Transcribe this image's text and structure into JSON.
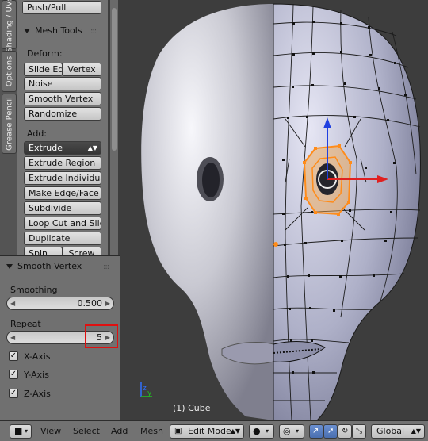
{
  "vertical_tabs": [
    "Shading / UVs",
    "Options",
    "Grease Pencil"
  ],
  "toolshelf": {
    "top_button": "Push/Pull",
    "mesh_tools": {
      "title": "Mesh Tools",
      "deform_label": "Deform:",
      "slide_edge": "Slide Ed",
      "vertex": "Vertex",
      "noise": "Noise",
      "smooth_vertex": "Smooth Vertex",
      "randomize": "Randomize",
      "add_label": "Add:",
      "extrude": "Extrude",
      "extrude_region": "Extrude Region",
      "extrude_individual": "Extrude Individual",
      "make_edge_face": "Make Edge/Face",
      "subdivide": "Subdivide",
      "loop_cut_slide": "Loop Cut and Slide",
      "duplicate": "Duplicate",
      "spin": "Spin",
      "screw": "Screw"
    }
  },
  "operator_panel": {
    "title": "Smooth Vertex",
    "smoothing_label": "Smoothing",
    "smoothing_value": "0.500",
    "repeat_label": "Repeat",
    "repeat_value": "5",
    "x_axis": "X-Axis",
    "y_axis": "Y-Axis",
    "z_axis": "Z-Axis",
    "x_checked": true,
    "y_checked": true,
    "z_checked": true
  },
  "viewport": {
    "object_label": "(1) Cube"
  },
  "header": {
    "menu_view": "View",
    "menu_select": "Select",
    "menu_mesh": "Mesh",
    "menu_add": "Add",
    "mode": "Edit Mode",
    "orientation": "Global"
  },
  "colors": {
    "highlight": "#e01010",
    "selection": "#ff8c1a",
    "x_axis": "#e02020",
    "z_axis": "#2040e0"
  }
}
